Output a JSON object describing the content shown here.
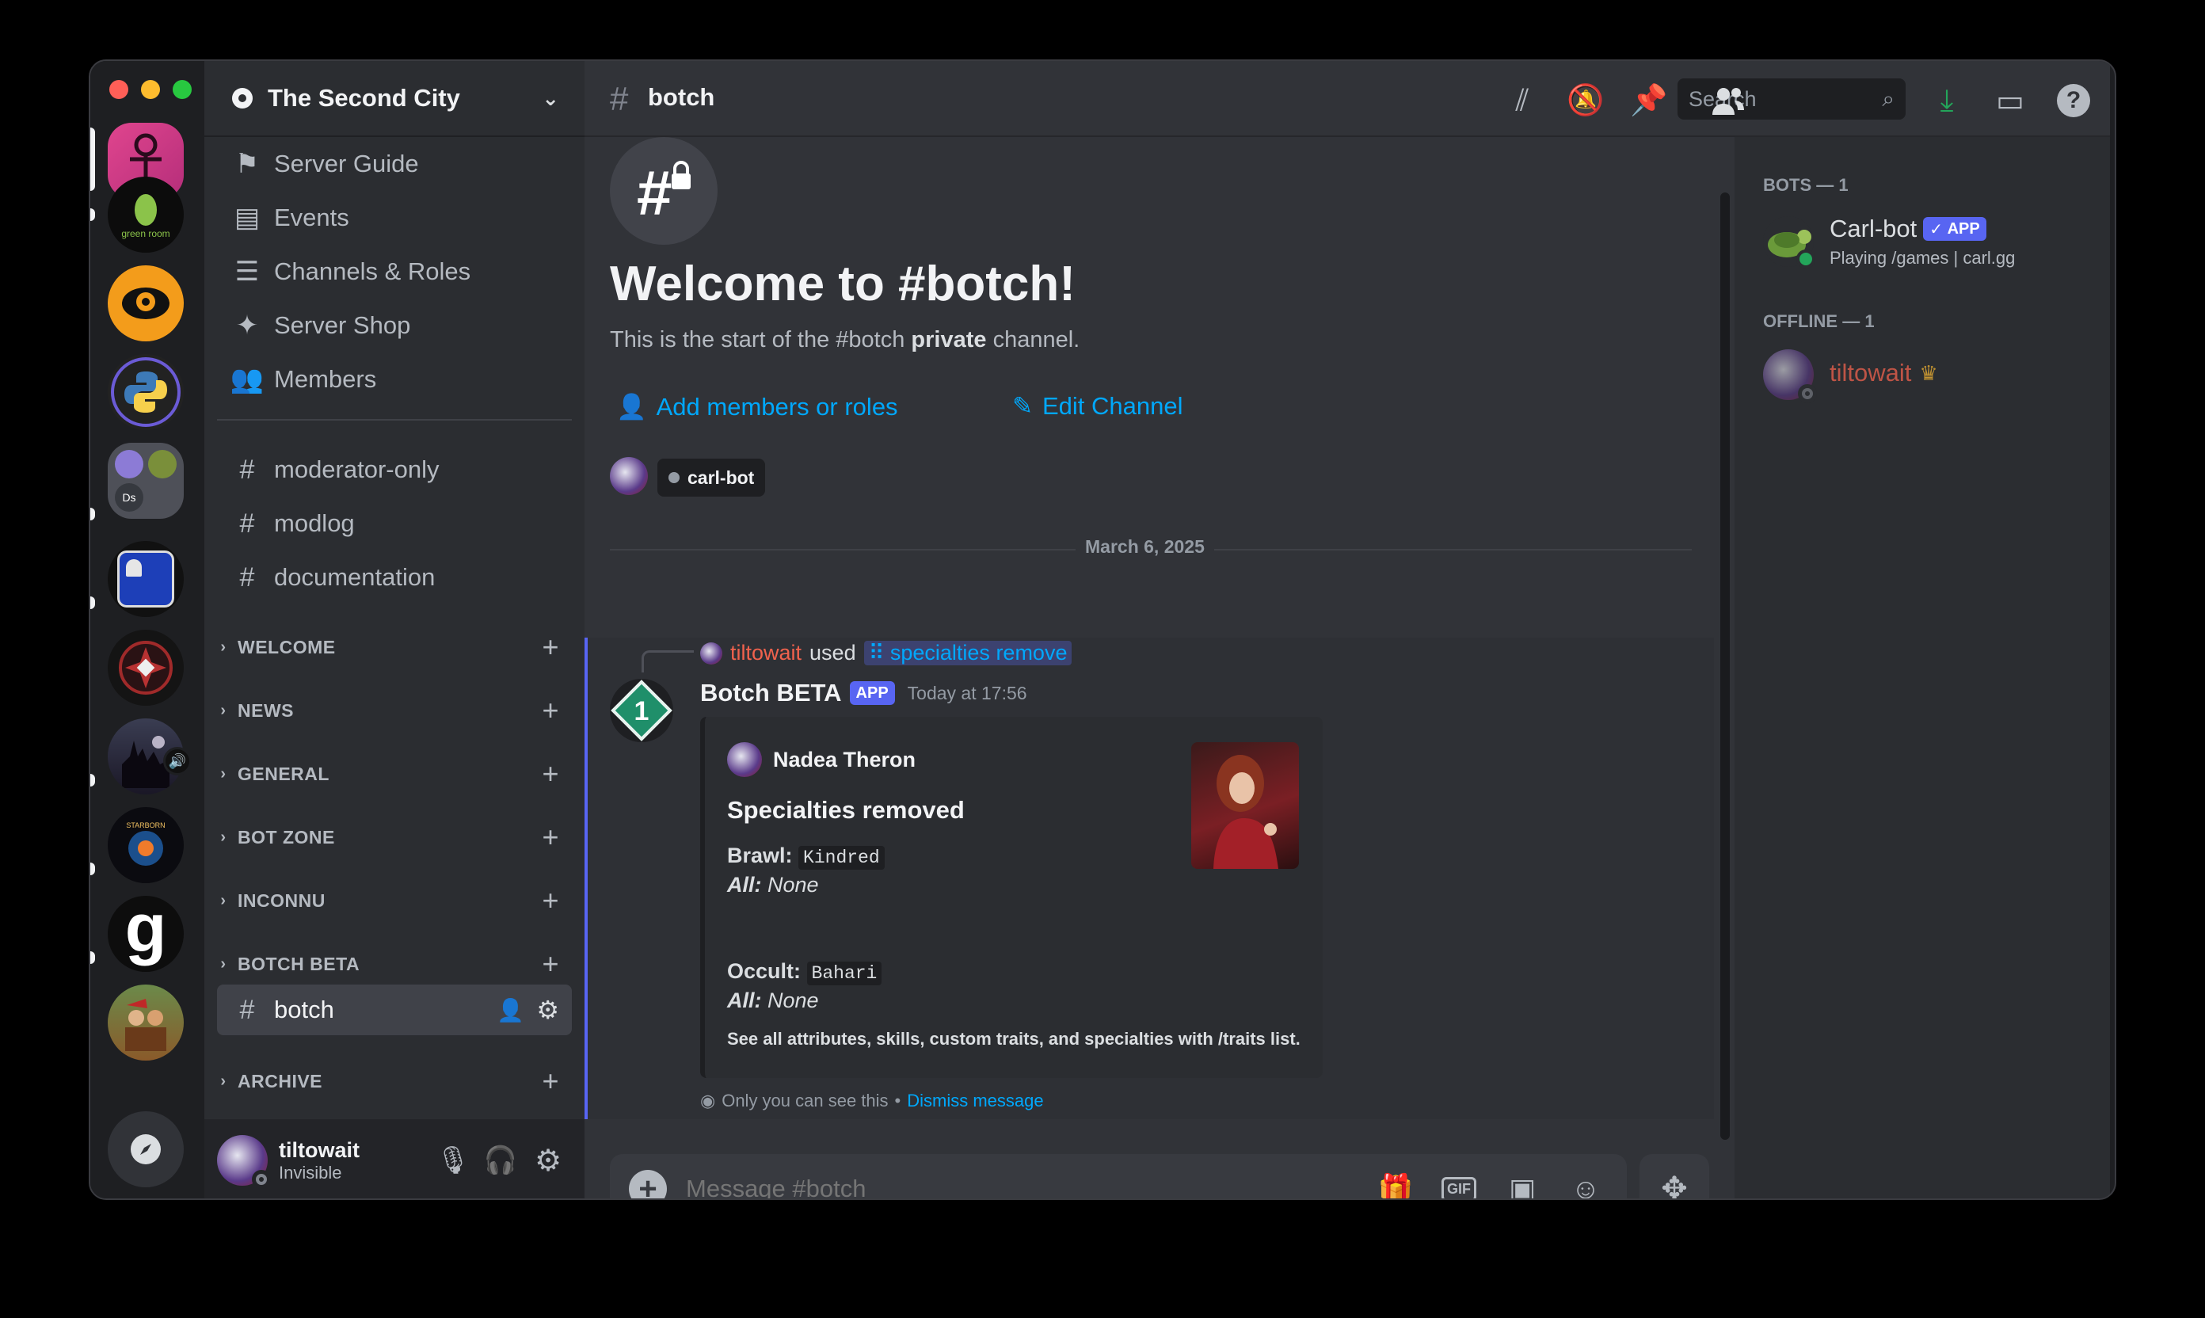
{
  "window": {
    "traffic_lights": [
      "#ff5f57",
      "#febc2e",
      "#28c840"
    ]
  },
  "server": {
    "name": "The Second City"
  },
  "nav_items": [
    {
      "label": "Server Guide",
      "icon": "signpost-icon"
    },
    {
      "label": "Events",
      "icon": "calendar-icon"
    },
    {
      "label": "Channels & Roles",
      "icon": "channels-browse-icon"
    },
    {
      "label": "Server Shop",
      "icon": "shop-icon"
    },
    {
      "label": "Members",
      "icon": "members-icon"
    }
  ],
  "channels": [
    "moderator-only",
    "modlog",
    "documentation"
  ],
  "categories": [
    "WELCOME",
    "NEWS",
    "GENERAL",
    "BOT ZONE",
    "INCONNU",
    "BOTCH BETA"
  ],
  "active_channel": "botch",
  "archive_category": "ARCHIVE",
  "user": {
    "name": "tiltowait",
    "status": "Invisible"
  },
  "topbar": {
    "channel": "botch",
    "search_placeholder": "Search"
  },
  "welcome": {
    "title": "Welcome to #botch!",
    "sub_pre": "This is the start of the #botch ",
    "sub_bold": "private",
    "sub_post": " channel.",
    "add_members": "Add members or roles",
    "edit_channel": "Edit Channel",
    "member_chip": "carl-bot"
  },
  "date_divider": "March 6, 2025",
  "message": {
    "reply_user": "tiltowait",
    "reply_used": "used",
    "reply_command": "specialties remove",
    "author": "Botch BETA",
    "app_tag": "APP",
    "time": "Today at 17:56",
    "embed": {
      "author": "Nadea Theron",
      "title": "Specialties removed",
      "fields": [
        {
          "name": "Brawl:",
          "code": "Kindred",
          "sub_label": "All:",
          "sub_value": "None"
        },
        {
          "name": "Occult:",
          "code": "Bahari",
          "sub_label": "All:",
          "sub_value": "None"
        }
      ],
      "footer": "See all attributes, skills, custom traits, and specialties with /traits list."
    },
    "ephemeral_note": "Only you can see this",
    "ephemeral_sep": " • ",
    "dismiss": "Dismiss message"
  },
  "composer": {
    "placeholder": "Message #botch",
    "gif_label": "GIF"
  },
  "members": {
    "bots_header": "BOTS — 1",
    "bot": {
      "name": "Carl-bot",
      "tag": "APP",
      "activity": "Playing /games | carl.gg"
    },
    "offline_header": "OFFLINE — 1",
    "offline_user": {
      "name": "tiltowait"
    }
  },
  "colors": {
    "blurple": "#5865f2",
    "link": "#00a8fc",
    "owner_name": "#f0624d",
    "green": "#23a55a",
    "crown": "#f0b232"
  }
}
